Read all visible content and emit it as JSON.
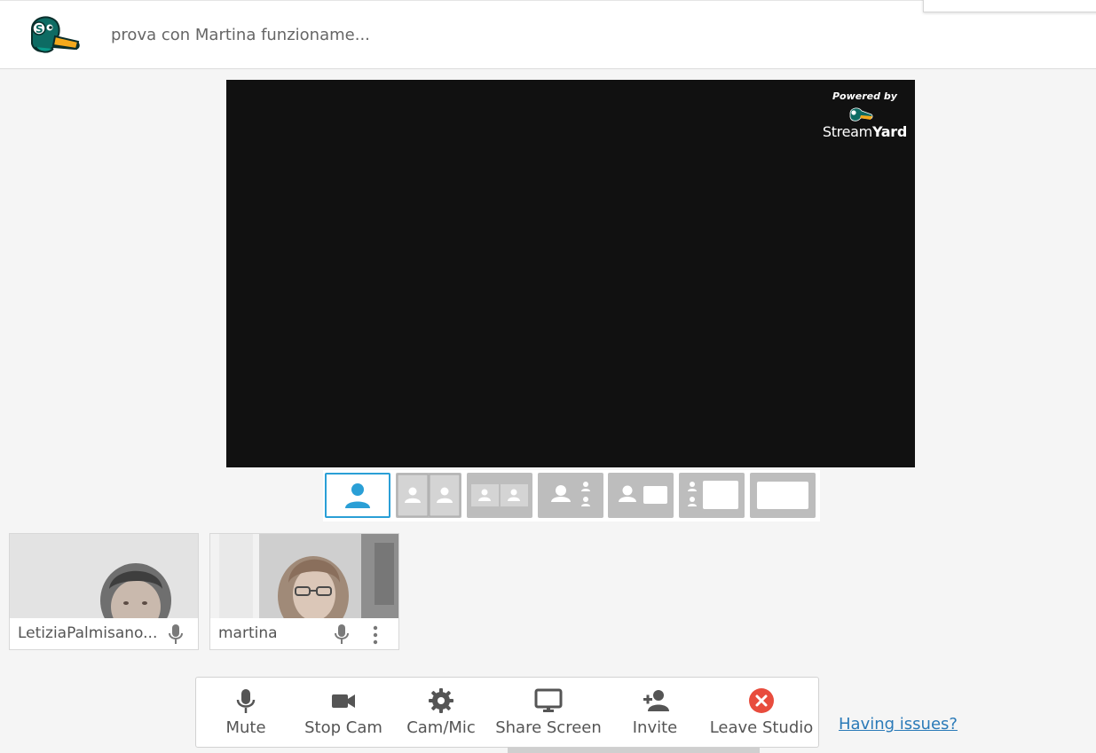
{
  "header": {
    "logo": "streamyard-duck-logo",
    "broadcast_title": "prova con Martina funzioname..."
  },
  "stage": {
    "watermark_top": "Powered by",
    "watermark_brand_a": "Stream",
    "watermark_brand_b": "Yard"
  },
  "layouts": [
    {
      "name": "solo",
      "active": true
    },
    {
      "name": "cropped",
      "active": false
    },
    {
      "name": "group",
      "active": false
    },
    {
      "name": "leader",
      "active": false
    },
    {
      "name": "screen-thumbnail",
      "active": false
    },
    {
      "name": "screen-sidebar",
      "active": false
    },
    {
      "name": "screen-only",
      "active": false
    }
  ],
  "participants": [
    {
      "name": "LetiziaPalmisano...",
      "mic": "mic-icon"
    },
    {
      "name": "martina",
      "mic": "mic-icon",
      "menu": "more-vert-icon"
    }
  ],
  "toolbar": {
    "mute": "Mute",
    "stop_cam": "Stop Cam",
    "cam_mic": "Cam/Mic",
    "share_screen": "Share Screen",
    "invite": "Invite",
    "leave": "Leave Studio"
  },
  "help_link": "Having issues?",
  "colors": {
    "accent": "#2a9fd6",
    "leave_red": "#e84c3d",
    "stage_bg": "#111111",
    "layout_inactive": "#bdbdbd"
  }
}
